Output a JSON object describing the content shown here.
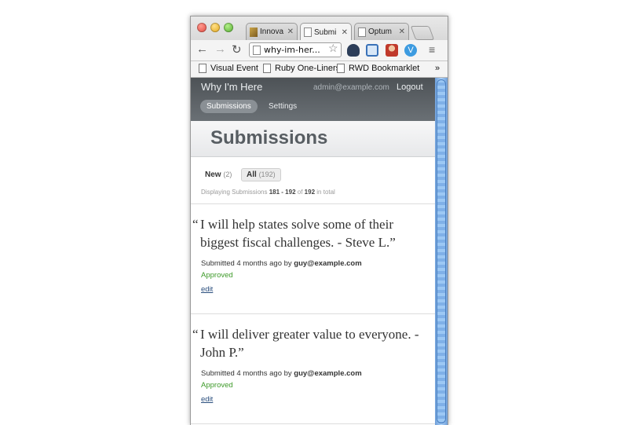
{
  "browser": {
    "tabs": [
      {
        "label": "Innova",
        "active": false
      },
      {
        "label": "Submi",
        "active": true
      },
      {
        "label": "Optum",
        "active": false
      }
    ],
    "url": "why-im-her...",
    "bookmarks": [
      "Visual Event",
      "Ruby One-Liners",
      "RWD Bookmarklet"
    ],
    "bookmarks_overflow": "»",
    "extensions": [
      "pot-icon",
      "screen-capture-icon",
      "person-icon",
      "v-badge-icon"
    ]
  },
  "app": {
    "brand": "Why I'm Here",
    "user_email": "admin@example.com",
    "logout_label": "Logout",
    "nav": {
      "submissions": "Submissions",
      "settings": "Settings"
    }
  },
  "page": {
    "title": "Submissions",
    "filters": {
      "new_label": "New",
      "new_count": "(2)",
      "all_label": "All",
      "all_count": "(192)"
    },
    "paging": {
      "prefix": "Displaying Submissions",
      "range": "181 - 192",
      "of": "of",
      "total": "192",
      "suffix": "in total"
    }
  },
  "submissions": [
    {
      "open_quote": "“",
      "text": "I will help states solve some of their biggest fiscal challenges. - Steve L.”",
      "meta_prefix": "Submitted 4 months ago by",
      "author": "guy@example.com",
      "status": "Approved",
      "edit_label": "edit"
    },
    {
      "open_quote": "“",
      "text": "I will deliver greater value to everyone. - John P.”",
      "meta_prefix": "Submitted 4 months ago by",
      "author": "guy@example.com",
      "status": "Approved",
      "edit_label": "edit"
    }
  ],
  "colors": {
    "header": "#5a6065",
    "approved": "#3e9a2a",
    "link": "#2b4f7e"
  }
}
